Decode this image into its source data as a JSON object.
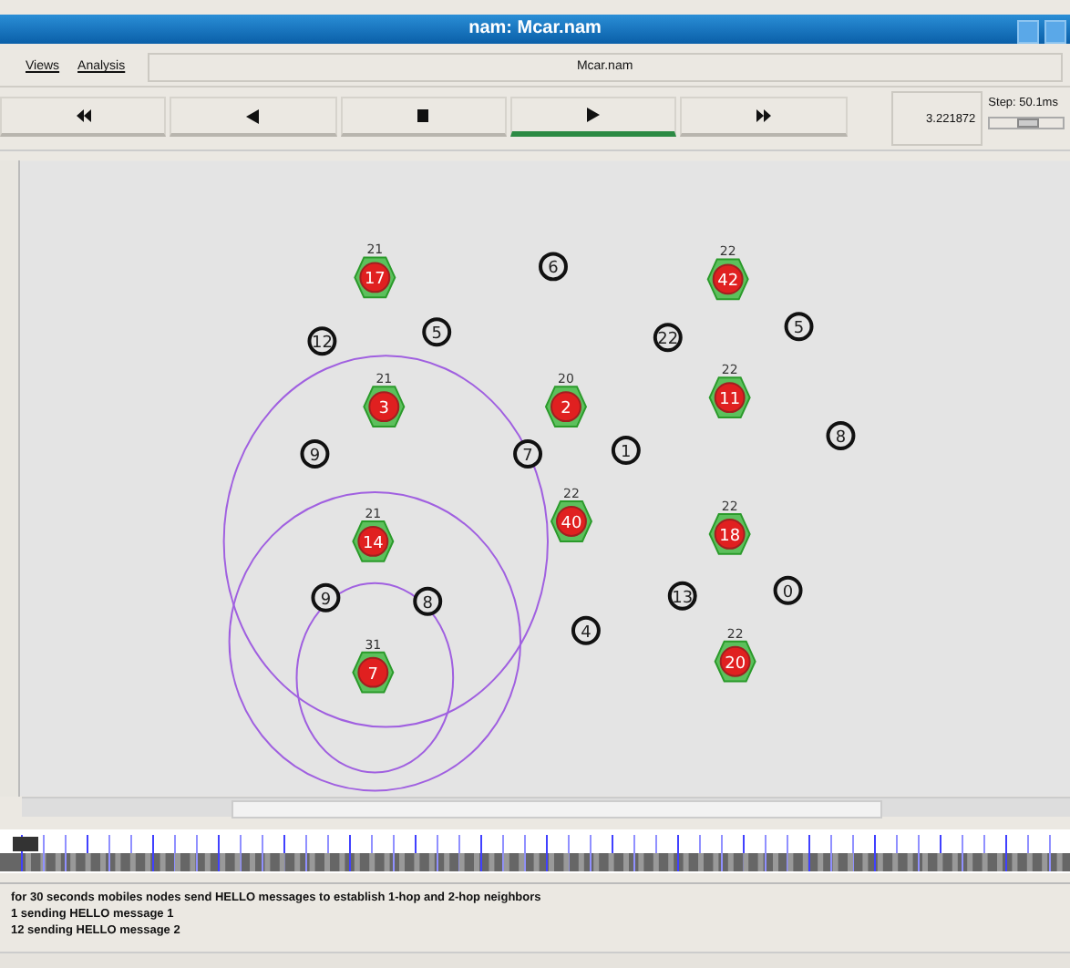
{
  "window": {
    "title": "nam: Mcar.nam"
  },
  "menu": [
    {
      "label": "Views"
    },
    {
      "label": "Analysis"
    }
  ],
  "file_field": {
    "value": "Mcar.nam"
  },
  "playback": [
    {
      "kind": "rewind",
      "selected": false
    },
    {
      "kind": "back",
      "selected": false
    },
    {
      "kind": "stop",
      "selected": false
    },
    {
      "kind": "play",
      "selected": true
    },
    {
      "kind": "forward",
      "selected": false
    }
  ],
  "time": "3.221872",
  "step": {
    "label": "Step: 50.1ms",
    "level": 0.5
  },
  "nodes": [
    {
      "kind": "head",
      "label": "17",
      "tag": "21"
    },
    {
      "kind": "head",
      "label": "3",
      "tag": "21"
    },
    {
      "kind": "head",
      "label": "2",
      "tag": "20"
    },
    {
      "kind": "head",
      "label": "14",
      "tag": "21"
    },
    {
      "kind": "head",
      "label": "7",
      "tag": "31"
    },
    {
      "kind": "head",
      "label": "40",
      "tag": "22"
    },
    {
      "kind": "head",
      "label": "42",
      "tag": "22"
    },
    {
      "kind": "head",
      "label": "11",
      "tag": "22"
    },
    {
      "kind": "head",
      "label": "18",
      "tag": "22"
    },
    {
      "kind": "head",
      "label": "20",
      "tag": "22"
    },
    {
      "kind": "plain",
      "label": "6"
    },
    {
      "kind": "plain",
      "label": "12"
    },
    {
      "kind": "plain",
      "label": "5"
    },
    {
      "kind": "plain",
      "label": "22"
    },
    {
      "kind": "plain",
      "label": "5"
    },
    {
      "kind": "plain",
      "label": "9"
    },
    {
      "kind": "plain",
      "label": "7"
    },
    {
      "kind": "plain",
      "label": "1"
    },
    {
      "kind": "plain",
      "label": "8"
    },
    {
      "kind": "plain",
      "label": "9"
    },
    {
      "kind": "plain",
      "label": "8"
    },
    {
      "kind": "plain",
      "label": "4"
    },
    {
      "kind": "plain",
      "label": "13"
    },
    {
      "kind": "plain",
      "label": "0"
    }
  ],
  "log": [
    "for 30 seconds mobiles nodes send HELLO messages to establish 1-hop and 2-hop neighbors",
    "1 sending HELLO message 1",
    "12 sending HELLO message 2"
  ]
}
